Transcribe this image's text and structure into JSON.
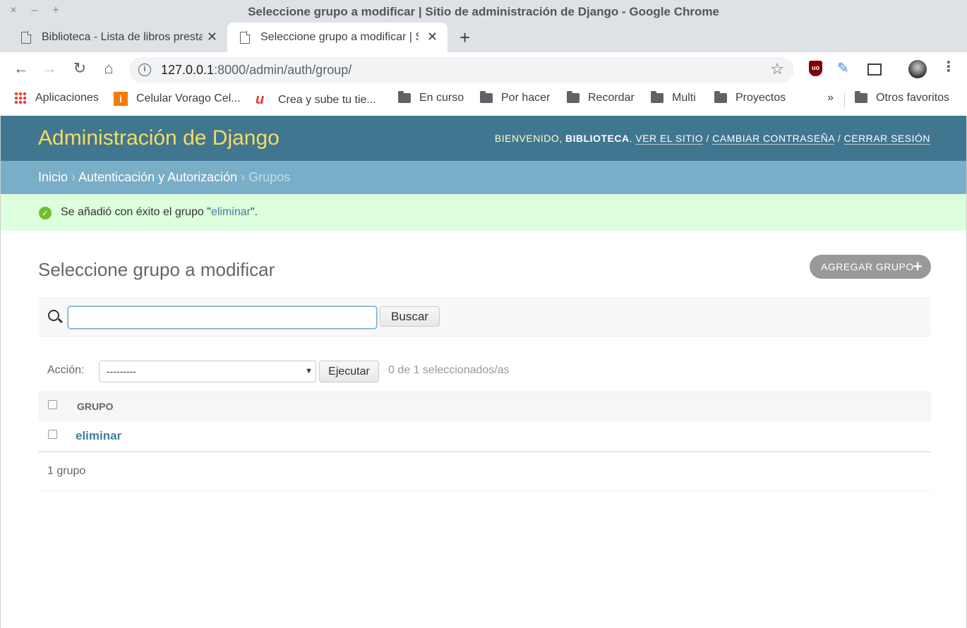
{
  "window": {
    "title": "Seleccione grupo a modificar | Sitio de administración de Django - Google Chrome",
    "controls": [
      "×",
      "–",
      "+"
    ]
  },
  "tabs": [
    {
      "title": "Biblioteca - Lista de libros prestados"
    },
    {
      "title": "Seleccione grupo a modificar | Sitio de administración de Django"
    }
  ],
  "address_bar": {
    "host": "127.0.0.1",
    "rest": ":8000/admin/auth/group/"
  },
  "bookmarks": [
    {
      "label": "Aplicaciones"
    },
    {
      "label": "Celular Vorago Cel..."
    },
    {
      "label": "Crea y sube tu tie..."
    },
    {
      "label": "En curso"
    },
    {
      "label": "Por hacer"
    },
    {
      "label": "Recordar"
    },
    {
      "label": "Multi"
    },
    {
      "label": "Proyectos"
    },
    {
      "label": "Otros favoritos"
    }
  ],
  "admin": {
    "branding": "Administración de Django",
    "welcome": "BIENVENIDO,",
    "username": "BIBLIOTECA",
    "view_site": "VER EL SITIO",
    "change_password": "CAMBIAR CONTRASEÑA",
    "logout": "CERRAR SESIÓN",
    "separator": "/"
  },
  "breadcrumbs": {
    "home": "Inicio",
    "app": "Autenticación y Autorización",
    "current": "Grupos",
    "sep": "›"
  },
  "message": {
    "prefix": "Se añadió con éxito el grupo \"",
    "link": "eliminar",
    "suffix": "\"."
  },
  "content": {
    "title": "Seleccione grupo a modificar",
    "add_button": "AGREGAR GRUPO",
    "search_placeholder": "",
    "search_button": "Buscar",
    "action_label": "Acción:",
    "action_selected": "---------",
    "action_button": "Ejecutar",
    "action_counter": "0 de 1 seleccionados/as",
    "column_header": "GRUPO",
    "rows": [
      {
        "name": "eliminar"
      }
    ],
    "result_count": "1 grupo"
  },
  "colors": {
    "header": "#417690",
    "branding": "#f5dd5d",
    "breadcrumbs": "#79aec8",
    "success": "#dfd",
    "link": "#447e9b"
  },
  "icons": [
    "back-icon",
    "forward-icon",
    "reload-icon",
    "home-icon",
    "info-icon",
    "star-icon",
    "ublock-icon",
    "feather-icon",
    "cast-icon",
    "avatar",
    "menu-icon",
    "search-icon",
    "success-icon",
    "plus-icon"
  ]
}
